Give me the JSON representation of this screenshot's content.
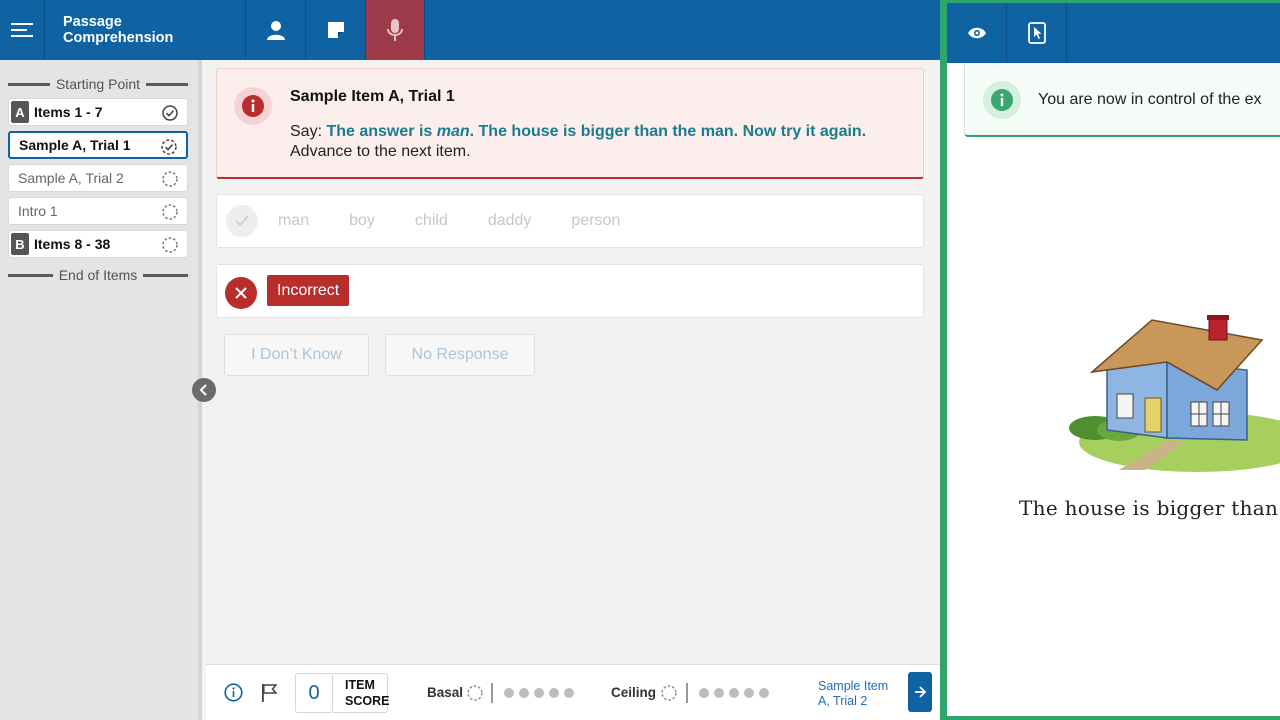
{
  "header": {
    "title": "Passage Comprehension",
    "icons": [
      "menu-icon",
      "person-icon",
      "note-icon",
      "microphone-icon"
    ]
  },
  "sidebar": {
    "start_label": "Starting Point",
    "end_label": "End of Items",
    "items": [
      {
        "letter": "A",
        "label": "Items 1 - 7",
        "status": "complete"
      },
      {
        "label": "Sample A, Trial 1",
        "status": "in-progress",
        "active": true
      },
      {
        "label": "Sample A, Trial 2",
        "status": "pending"
      },
      {
        "label": "Intro 1",
        "status": "pending"
      },
      {
        "letter": "B",
        "label": "Items 8 - 38",
        "status": "pending"
      }
    ]
  },
  "alert": {
    "title": "Sample Item A, Trial 1",
    "say_prefix": "Say: ",
    "say_part1": "The answer is ",
    "say_emph": "man",
    "say_part2": ". The house is bigger than the man. Now try it again.",
    "instruction": "Advance to the next item."
  },
  "options": [
    "man",
    "boy",
    "child",
    "daddy",
    "person"
  ],
  "result": {
    "label": "Incorrect",
    "color": "#b92d2d"
  },
  "buttons": {
    "dont_know": "I Don’t Know",
    "no_response": "No Response"
  },
  "footer": {
    "score_value": "0",
    "score_label_1": "ITEM",
    "score_label_2": "SCORE",
    "basal_label": "Basal",
    "ceiling_label": "Ceiling",
    "next_item": "Sample Item A, Trial 2"
  },
  "examinee": {
    "notice": "You are now in control of the ex",
    "caption": "The house is bigger than th"
  },
  "colors": {
    "brand_blue": "#0f63a3",
    "mic_active": "#9c3a4a",
    "examinee_border": "#2ea56c",
    "say_text": "#177d8f"
  }
}
